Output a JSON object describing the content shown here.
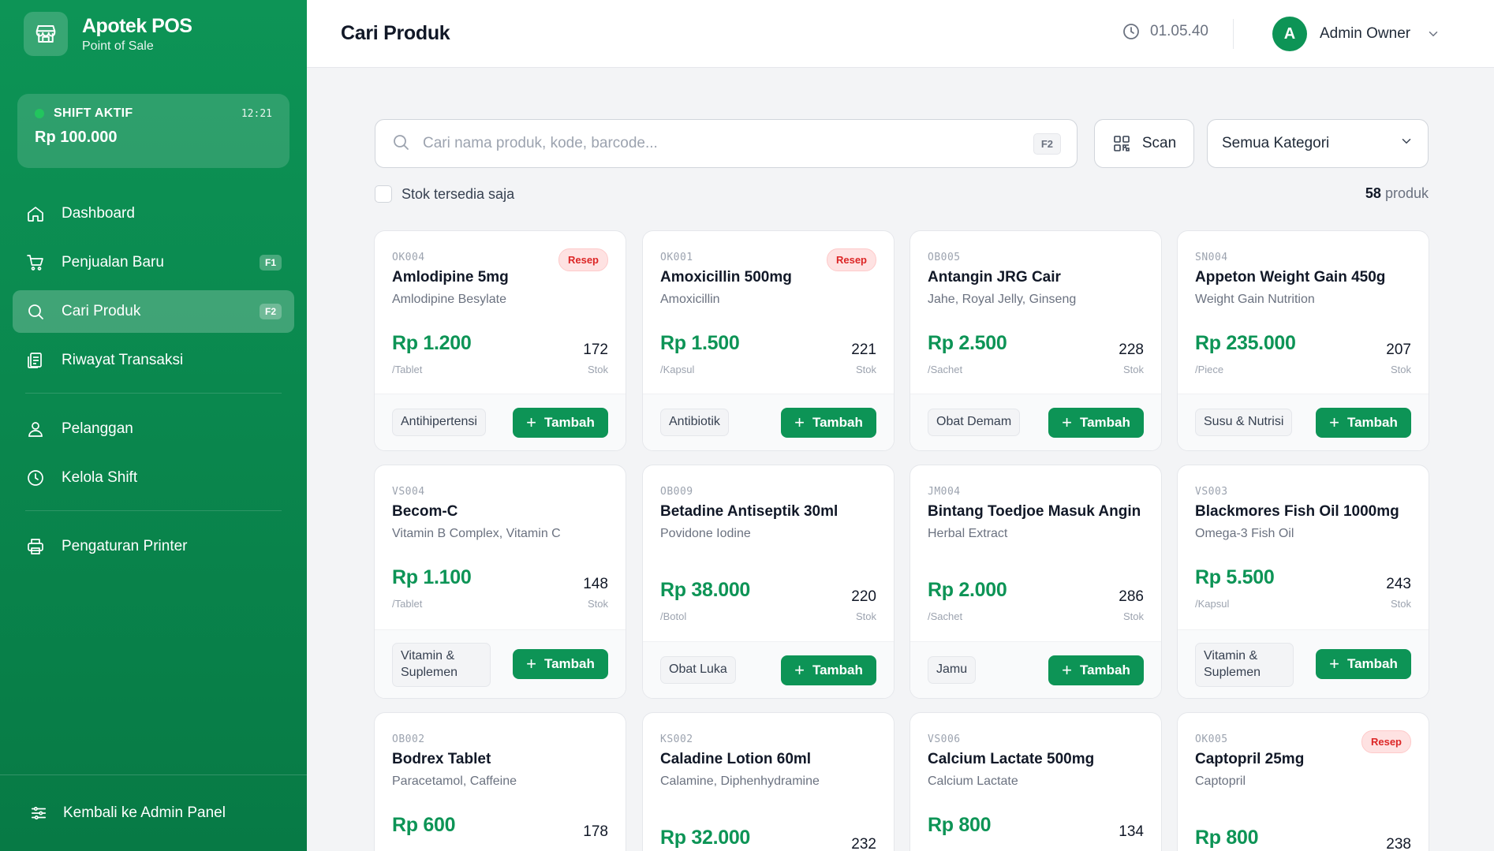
{
  "app": {
    "title": "Apotek POS",
    "subtitle": "Point of Sale"
  },
  "shift": {
    "label": "SHIFT AKTIF",
    "time": "12:21",
    "amount": "Rp 100.000"
  },
  "nav": [
    {
      "label": "Dashboard",
      "icon": "home-icon"
    },
    {
      "label": "Penjualan Baru",
      "icon": "cart-icon",
      "shortcut": "F1"
    },
    {
      "label": "Cari Produk",
      "icon": "search-icon",
      "shortcut": "F2",
      "active": true
    },
    {
      "label": "Riwayat Transaksi",
      "icon": "receipt-icon"
    },
    {
      "label": "Pelanggan",
      "icon": "user-icon"
    },
    {
      "label": "Kelola Shift",
      "icon": "clock-icon"
    },
    {
      "label": "Pengaturan Printer",
      "icon": "printer-icon"
    }
  ],
  "footer": {
    "label": "Kembali ke Admin Panel"
  },
  "header": {
    "title": "Cari Produk",
    "clock": "01.05.40",
    "user_initial": "A",
    "user_name": "Admin Owner"
  },
  "search": {
    "placeholder": "Cari nama produk, kode, barcode...",
    "shortcut": "F2",
    "value": ""
  },
  "scan": {
    "label": "Scan"
  },
  "category": {
    "selected": "Semua Kategori"
  },
  "filter": {
    "label": "Stok tersedia saja"
  },
  "count": {
    "number": "58",
    "label": "produk"
  },
  "colors": {
    "accent": "#0d9456",
    "resep": "#dc2626"
  },
  "products": [
    {
      "code": "OK004",
      "resep": "Resep",
      "name": "Amlodipine 5mg",
      "generic": "Amlodipine Besylate",
      "price": "Rp 1.200",
      "unit": "/Tablet",
      "stock": "172",
      "stock_label": "Stok",
      "category": "Antihipertensi",
      "add": "Tambah"
    },
    {
      "code": "OK001",
      "resep": "Resep",
      "name": "Amoxicillin 500mg",
      "generic": "Amoxicillin",
      "price": "Rp 1.500",
      "unit": "/Kapsul",
      "stock": "221",
      "stock_label": "Stok",
      "category": "Antibiotik",
      "add": "Tambah"
    },
    {
      "code": "OB005",
      "name": "Antangin JRG Cair",
      "generic": "Jahe, Royal Jelly, Ginseng",
      "price": "Rp 2.500",
      "unit": "/Sachet",
      "stock": "228",
      "stock_label": "Stok",
      "category": "Obat Demam",
      "add": "Tambah"
    },
    {
      "code": "SN004",
      "name": "Appeton Weight Gain 450g",
      "generic": "Weight Gain Nutrition",
      "price": "Rp 235.000",
      "unit": "/Piece",
      "stock": "207",
      "stock_label": "Stok",
      "category": "Susu & Nutrisi",
      "add": "Tambah"
    },
    {
      "code": "VS004",
      "name": "Becom-C",
      "generic": "Vitamin B Complex, Vitamin C",
      "price": "Rp 1.100",
      "unit": "/Tablet",
      "stock": "148",
      "stock_label": "Stok",
      "category": "Vitamin & Suplemen",
      "add": "Tambah"
    },
    {
      "code": "OB009",
      "name": "Betadine Antiseptik 30ml",
      "generic": "Povidone Iodine",
      "price": "Rp 38.000",
      "unit": "/Botol",
      "stock": "220",
      "stock_label": "Stok",
      "category": "Obat Luka",
      "add": "Tambah"
    },
    {
      "code": "JM004",
      "name": "Bintang Toedjoe Masuk Angin",
      "generic": "Herbal Extract",
      "price": "Rp 2.000",
      "unit": "/Sachet",
      "stock": "286",
      "stock_label": "Stok",
      "category": "Jamu",
      "add": "Tambah"
    },
    {
      "code": "VS003",
      "name": "Blackmores Fish Oil 1000mg",
      "generic": "Omega-3 Fish Oil",
      "price": "Rp 5.500",
      "unit": "/Kapsul",
      "stock": "243",
      "stock_label": "Stok",
      "category": "Vitamin & Suplemen",
      "add": "Tambah"
    },
    {
      "code": "OB002",
      "name": "Bodrex Tablet",
      "generic": "Paracetamol, Caffeine",
      "price": "Rp 600",
      "stock": "178"
    },
    {
      "code": "KS002",
      "name": "Caladine Lotion 60ml",
      "generic": "Calamine, Diphenhydramine",
      "price": "Rp 32.000",
      "stock": "232"
    },
    {
      "code": "VS006",
      "name": "Calcium Lactate 500mg",
      "generic": "Calcium Lactate",
      "price": "Rp 800",
      "stock": "134"
    },
    {
      "code": "OK005",
      "resep": "Resep",
      "name": "Captopril 25mg",
      "generic": "Captopril",
      "price": "Rp 800",
      "stock": "238"
    }
  ]
}
